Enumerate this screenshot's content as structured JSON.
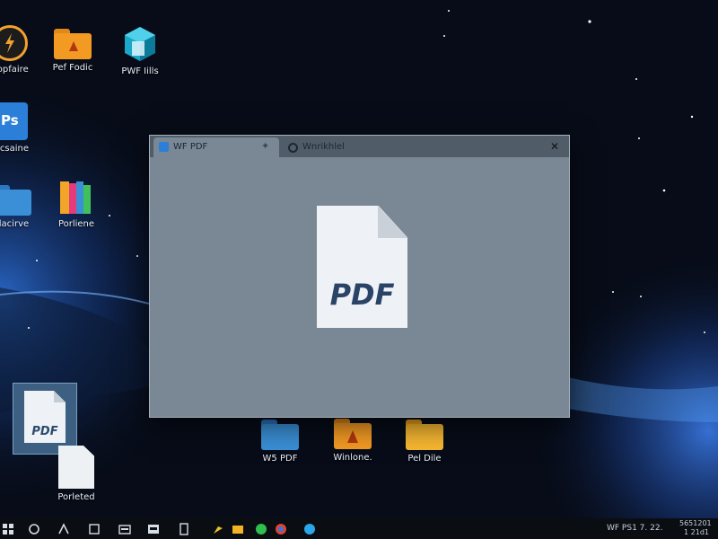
{
  "desktop_icons": [
    {
      "label": "Ropfaire",
      "icon": "power-app-icon"
    },
    {
      "label": "Pef Fodic",
      "icon": "folder-icon"
    },
    {
      "label": "PWF Iills",
      "icon": "document-stack-icon"
    },
    {
      "label": "Ocsaine",
      "icon": "pdf-app-icon"
    },
    {
      "label": "Ilacirve",
      "icon": "folder-icon"
    },
    {
      "label": "Porliene",
      "icon": "colorful-folder-icon"
    },
    {
      "label": "Porleted",
      "icon": "document-icon"
    },
    {
      "label": "W5 PDF",
      "icon": "folder-icon"
    },
    {
      "label": "Winlone.",
      "icon": "pdf-folder-icon"
    },
    {
      "label": "Pel Dile",
      "icon": "folder-icon"
    }
  ],
  "selected_file": {
    "badge": "PDF"
  },
  "window": {
    "tabs": [
      {
        "label": "WF PDF"
      },
      {
        "label": "Wnrikhlel"
      }
    ],
    "close_symbol": "✕",
    "document_badge": "PDF"
  },
  "taskbar": {
    "items": [
      "start",
      "search",
      "task-view",
      "files",
      "folder",
      "store",
      "docs",
      "pin",
      "folder-yellow",
      "app-green",
      "chrome",
      "app-blue"
    ],
    "tray_left": "WF PS1 7. 22.",
    "tray_right_top": "5651201",
    "tray_right_bottom": "1 21d1"
  },
  "colors": {
    "folder_blue": "#3a8fd6",
    "folder_orange": "#f3a52a",
    "window_bg": "#7a8794"
  }
}
